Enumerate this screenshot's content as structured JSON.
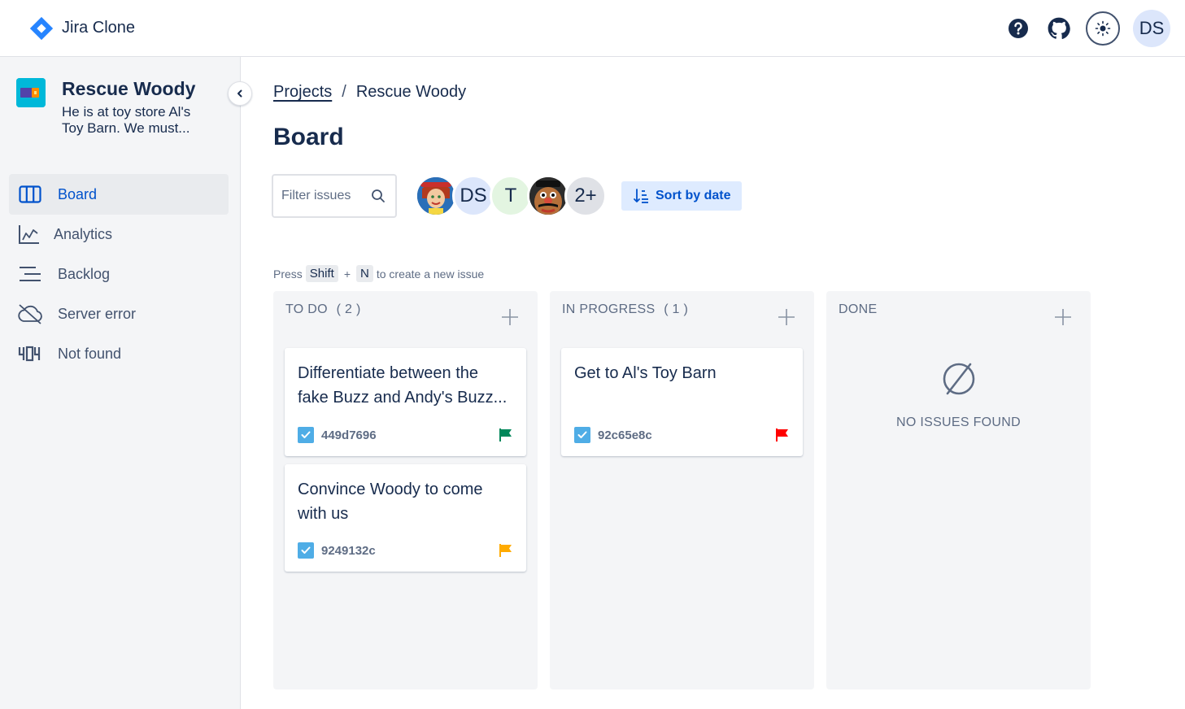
{
  "app": {
    "name": "Jira Clone",
    "user_initials": "DS"
  },
  "project": {
    "name": "Rescue Woody",
    "description_line1": "He is at toy store Al's",
    "description_line2": "Toy Barn. We must..."
  },
  "sidebar": {
    "items": [
      {
        "label": "Board",
        "icon": "board-icon",
        "active": true
      },
      {
        "label": "Analytics",
        "icon": "analytics-icon",
        "active": false
      },
      {
        "label": "Backlog",
        "icon": "backlog-icon",
        "active": false
      },
      {
        "label": "Server error",
        "icon": "cloud-off-icon",
        "active": false
      },
      {
        "label": "Not found",
        "icon": "404-icon",
        "active": false
      }
    ]
  },
  "breadcrumb": {
    "root": "Projects",
    "separator": "/",
    "current": "Rescue Woody"
  },
  "page": {
    "title": "Board"
  },
  "filters": {
    "search_placeholder": "Filter issues",
    "members": [
      "Jessie",
      "DS",
      "T",
      "Mr. Potato Head"
    ],
    "more": "2+",
    "sort_label": "Sort by date"
  },
  "hint": {
    "press": "Press",
    "key1": "Shift",
    "plus": "+",
    "key2": "N",
    "rest": "to create a new issue"
  },
  "columns": [
    {
      "title": "TO DO",
      "count": "( 2 )",
      "cards": [
        {
          "title": "Differentiate between the fake Buzz and Andy's Buzz...",
          "id": "449d7696",
          "priority_color": "#00875a"
        },
        {
          "title": "Convince Woody to come with us",
          "id": "9249132c",
          "priority_color": "#ffab00"
        }
      ]
    },
    {
      "title": "IN PROGRESS",
      "count": "( 1 )",
      "cards": [
        {
          "title": "Get to Al's Toy Barn",
          "id": "92c65e8c",
          "priority_color": "#ff0000"
        }
      ]
    },
    {
      "title": "DONE",
      "count": "",
      "empty_text": "NO ISSUES FOUND",
      "cards": []
    }
  ],
  "colors": {
    "accent": "#0052cc",
    "brand": "#2684ff",
    "sidebar_bg": "#f4f5f7"
  }
}
